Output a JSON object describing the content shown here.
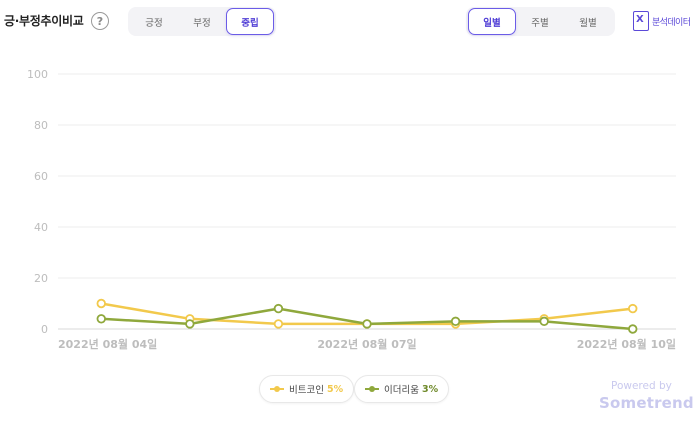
{
  "header": {
    "title": "긍·부정추이비교",
    "help_glyph": "?",
    "sentiment_tabs": [
      {
        "label": "긍정",
        "active": false
      },
      {
        "label": "부정",
        "active": false
      },
      {
        "label": "중립",
        "active": true
      }
    ],
    "period_tabs": [
      {
        "label": "일별",
        "active": true
      },
      {
        "label": "주별",
        "active": false
      },
      {
        "label": "월별",
        "active": false
      }
    ],
    "export_label": "분석데이터",
    "export_icon": "excel-icon"
  },
  "legend": [
    {
      "label": "비트코인",
      "pct": "5%",
      "color": "#f2c94c",
      "pct_color": "#f2c94c"
    },
    {
      "label": "이더리움",
      "pct": "3%",
      "color": "#8fa83c",
      "pct_color": "#6f8a2a"
    }
  ],
  "footer": {
    "powered": "Powered by",
    "brand": "Sometrend"
  },
  "chart_data": {
    "type": "line",
    "x": [
      "2022-08-04",
      "2022-08-05",
      "2022-08-06",
      "2022-08-07",
      "2022-08-08",
      "2022-08-09",
      "2022-08-10"
    ],
    "x_tick_labels": [
      "2022년 08월 04일",
      "2022년 08월 07일",
      "2022년 08월 10일"
    ],
    "x_tick_dates": [
      "2022-08-04",
      "2022-08-07",
      "2022-08-10"
    ],
    "y_ticks": [
      0,
      20,
      40,
      60,
      80,
      100
    ],
    "ylim": [
      0,
      100
    ],
    "grid": true,
    "legend_placement": "bottom-center",
    "series": [
      {
        "name": "비트코인",
        "color": "#f2c94c",
        "values": [
          10,
          4,
          2,
          2,
          2,
          4,
          8
        ]
      },
      {
        "name": "이더리움",
        "color": "#8fa83c",
        "values": [
          4,
          2,
          8,
          2,
          3,
          3,
          0
        ]
      }
    ]
  }
}
